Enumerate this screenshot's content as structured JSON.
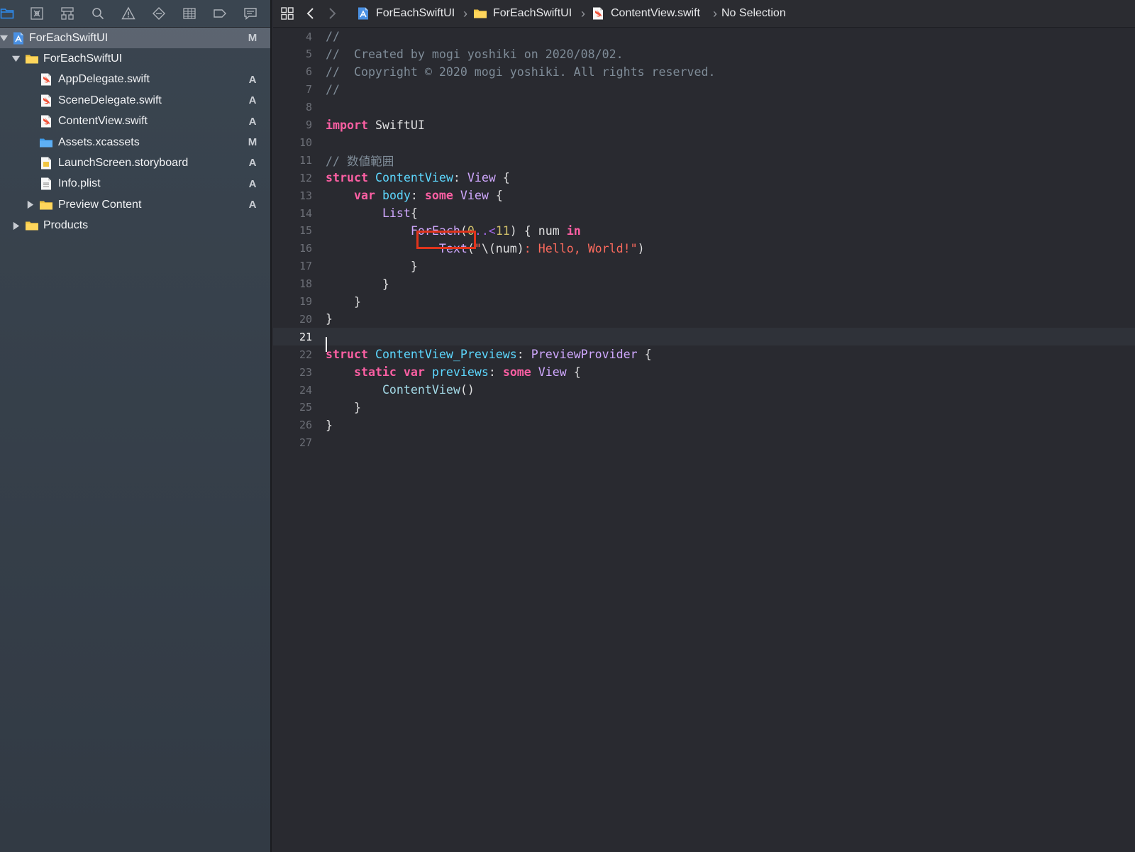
{
  "sidebar": {
    "toolbar": [
      {
        "icon": "folder-icon",
        "label": "Project navigator"
      },
      {
        "icon": "source-control-icon",
        "label": "Source control navigator"
      },
      {
        "icon": "symbol-icon",
        "label": "Symbol navigator"
      },
      {
        "icon": "search-icon",
        "label": "Find navigator"
      },
      {
        "icon": "warning-icon",
        "label": "Issue navigator"
      },
      {
        "icon": "diamond-icon",
        "label": "Test navigator"
      },
      {
        "icon": "list-icon",
        "label": "Debug navigator"
      },
      {
        "icon": "tag-icon",
        "label": "Breakpoint navigator"
      },
      {
        "icon": "message-icon",
        "label": "Report navigator"
      }
    ],
    "tree": [
      {
        "label": "ForEachSwiftUI",
        "status": "M",
        "icon": "project-icon",
        "level": 0,
        "disclosure": "open",
        "selected": true
      },
      {
        "label": "ForEachSwiftUI",
        "status": "",
        "icon": "folder-icon",
        "level": 1,
        "disclosure": "open",
        "selected": false
      },
      {
        "label": "AppDelegate.swift",
        "status": "A",
        "icon": "swift-file-icon",
        "level": 2,
        "disclosure": "",
        "selected": false
      },
      {
        "label": "SceneDelegate.swift",
        "status": "A",
        "icon": "swift-file-icon",
        "level": 2,
        "disclosure": "",
        "selected": false
      },
      {
        "label": "ContentView.swift",
        "status": "A",
        "icon": "swift-file-icon",
        "level": 2,
        "disclosure": "",
        "selected": false
      },
      {
        "label": "Assets.xcassets",
        "status": "M",
        "icon": "assets-folder-icon",
        "level": 2,
        "disclosure": "",
        "selected": false
      },
      {
        "label": "LaunchScreen.storyboard",
        "status": "A",
        "icon": "storyboard-file-icon",
        "level": 2,
        "disclosure": "",
        "selected": false
      },
      {
        "label": "Info.plist",
        "status": "A",
        "icon": "plist-file-icon",
        "level": 2,
        "disclosure": "",
        "selected": false
      },
      {
        "label": "Preview Content",
        "status": "A",
        "icon": "folder-icon",
        "level": 2,
        "disclosure": "closed",
        "selected": false
      },
      {
        "label": "Products",
        "status": "",
        "icon": "folder-icon",
        "level": 1,
        "disclosure": "closed",
        "selected": false
      }
    ]
  },
  "jumpbar": {
    "grid_icon": "grid-icon",
    "back_icon": "chevron-left-icon",
    "forward_icon": "chevron-right-icon",
    "crumbs": [
      {
        "label": "ForEachSwiftUI",
        "icon": "project-icon"
      },
      {
        "label": "ForEachSwiftUI",
        "icon": "folder-icon"
      },
      {
        "label": "ContentView.swift",
        "icon": "swift-file-icon"
      },
      {
        "label": "No Selection",
        "icon": ""
      }
    ]
  },
  "editor": {
    "current_line": 21,
    "highlight": {
      "line": 15,
      "text": "ForEach",
      "color": "#e0341c"
    },
    "lines": [
      {
        "n": "4",
        "tokens": [
          {
            "t": "//",
            "c": "cm"
          }
        ]
      },
      {
        "n": "5",
        "tokens": [
          {
            "t": "//  Created by mogi yoshiki on 2020/08/02.",
            "c": "cm"
          }
        ]
      },
      {
        "n": "6",
        "tokens": [
          {
            "t": "//  Copyright © 2020 mogi yoshiki. All rights reserved.",
            "c": "cm"
          }
        ]
      },
      {
        "n": "7",
        "tokens": [
          {
            "t": "//",
            "c": "cm"
          }
        ]
      },
      {
        "n": "8",
        "tokens": []
      },
      {
        "n": "9",
        "tokens": [
          {
            "t": "import",
            "c": "kw"
          },
          {
            "t": " SwiftUI",
            "c": "tx"
          }
        ]
      },
      {
        "n": "10",
        "tokens": []
      },
      {
        "n": "11",
        "tokens": [
          {
            "t": "// 数値範囲",
            "c": "cm"
          }
        ]
      },
      {
        "n": "12",
        "tokens": [
          {
            "t": "struct",
            "c": "kw"
          },
          {
            "t": " ",
            "c": "tx"
          },
          {
            "t": "ContentView",
            "c": "td"
          },
          {
            "t": ": ",
            "c": "tx"
          },
          {
            "t": "View",
            "c": "ty"
          },
          {
            "t": " {",
            "c": "tx"
          }
        ]
      },
      {
        "n": "13",
        "tokens": [
          {
            "t": "    ",
            "c": "tx"
          },
          {
            "t": "var",
            "c": "kw"
          },
          {
            "t": " ",
            "c": "tx"
          },
          {
            "t": "body",
            "c": "td"
          },
          {
            "t": ": ",
            "c": "tx"
          },
          {
            "t": "some",
            "c": "kw"
          },
          {
            "t": " ",
            "c": "tx"
          },
          {
            "t": "View",
            "c": "ty"
          },
          {
            "t": " {",
            "c": "tx"
          }
        ]
      },
      {
        "n": "14",
        "tokens": [
          {
            "t": "        ",
            "c": "tx"
          },
          {
            "t": "List",
            "c": "ty"
          },
          {
            "t": "{",
            "c": "tx"
          }
        ]
      },
      {
        "n": "15",
        "tokens": [
          {
            "t": "            ",
            "c": "tx"
          },
          {
            "t": "ForEach",
            "c": "ty"
          },
          {
            "t": "(",
            "c": "tx"
          },
          {
            "t": "0",
            "c": "nm"
          },
          {
            "t": "..<",
            "c": "sy"
          },
          {
            "t": "11",
            "c": "nm"
          },
          {
            "t": ") { num ",
            "c": "tx"
          },
          {
            "t": "in",
            "c": "kw"
          }
        ]
      },
      {
        "n": "16",
        "tokens": [
          {
            "t": "                ",
            "c": "tx"
          },
          {
            "t": "Text",
            "c": "ty"
          },
          {
            "t": "(",
            "c": "tx"
          },
          {
            "t": "\"",
            "c": "st"
          },
          {
            "t": "\\(num)",
            "c": "tx"
          },
          {
            "t": ": Hello, World!\"",
            "c": "st"
          },
          {
            "t": ")",
            "c": "tx"
          }
        ]
      },
      {
        "n": "17",
        "tokens": [
          {
            "t": "            }",
            "c": "tx"
          }
        ]
      },
      {
        "n": "18",
        "tokens": [
          {
            "t": "        }",
            "c": "tx"
          }
        ]
      },
      {
        "n": "19",
        "tokens": [
          {
            "t": "    }",
            "c": "tx"
          }
        ]
      },
      {
        "n": "20",
        "tokens": [
          {
            "t": "}",
            "c": "tx"
          }
        ]
      },
      {
        "n": "21",
        "tokens": []
      },
      {
        "n": "22",
        "tokens": [
          {
            "t": "struct",
            "c": "kw"
          },
          {
            "t": " ",
            "c": "tx"
          },
          {
            "t": "ContentView_Previews",
            "c": "td"
          },
          {
            "t": ": ",
            "c": "tx"
          },
          {
            "t": "PreviewProvider",
            "c": "ty"
          },
          {
            "t": " {",
            "c": "tx"
          }
        ]
      },
      {
        "n": "23",
        "tokens": [
          {
            "t": "    ",
            "c": "tx"
          },
          {
            "t": "static",
            "c": "kw"
          },
          {
            "t": " ",
            "c": "tx"
          },
          {
            "t": "var",
            "c": "kw"
          },
          {
            "t": " ",
            "c": "tx"
          },
          {
            "t": "previews",
            "c": "td"
          },
          {
            "t": ": ",
            "c": "tx"
          },
          {
            "t": "some",
            "c": "kw"
          },
          {
            "t": " ",
            "c": "tx"
          },
          {
            "t": "View",
            "c": "ty"
          },
          {
            "t": " {",
            "c": "tx"
          }
        ]
      },
      {
        "n": "24",
        "tokens": [
          {
            "t": "        ",
            "c": "tx"
          },
          {
            "t": "ContentView",
            "c": "fn"
          },
          {
            "t": "()",
            "c": "tx"
          }
        ]
      },
      {
        "n": "25",
        "tokens": [
          {
            "t": "    }",
            "c": "tx"
          }
        ]
      },
      {
        "n": "26",
        "tokens": [
          {
            "t": "}",
            "c": "tx"
          }
        ]
      },
      {
        "n": "27",
        "tokens": []
      }
    ]
  },
  "colors": {
    "sidebar_bg": "#343b45",
    "editor_bg": "#292a30",
    "comment": "#7f8c98",
    "keyword": "#fc5fa3",
    "declaration": "#5dd8ff",
    "type": "#d0a8ff",
    "string": "#fc6a5d",
    "number": "#d0bf69",
    "accent": "#2d8cf0"
  }
}
